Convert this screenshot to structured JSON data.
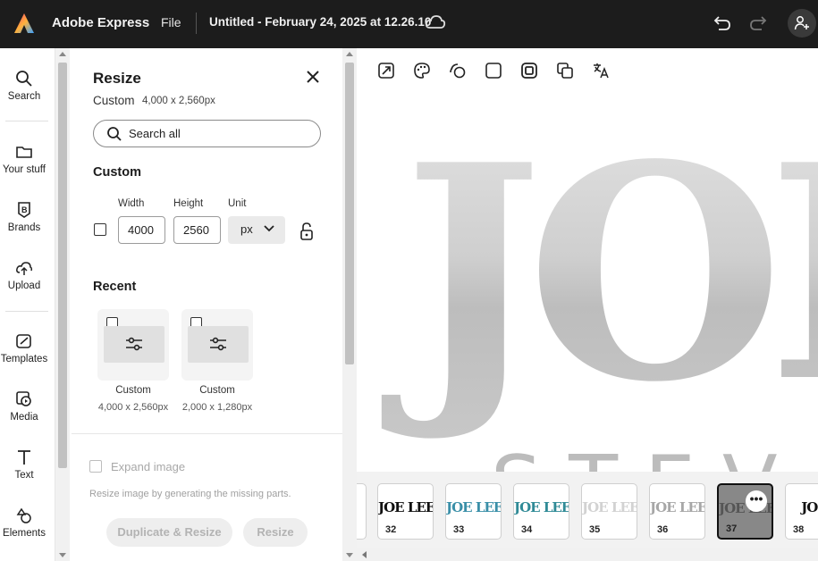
{
  "header": {
    "app_name": "Adobe Express",
    "file_menu": "File",
    "doc_title": "Untitled - February 24, 2025 at 12.26.10"
  },
  "rail": [
    {
      "label": "Search",
      "icon": "search-icon"
    },
    {
      "label": "Your stuff",
      "icon": "folder-icon"
    },
    {
      "label": "Brands",
      "icon": "brand-icon"
    },
    {
      "label": "Upload",
      "icon": "upload-icon"
    },
    {
      "label": "Templates",
      "icon": "templates-icon"
    },
    {
      "label": "Media",
      "icon": "media-icon"
    },
    {
      "label": "Text",
      "icon": "text-icon"
    },
    {
      "label": "Elements",
      "icon": "elements-icon"
    }
  ],
  "panel": {
    "title": "Resize",
    "current_name": "Custom",
    "current_dims": "4,000 x 2,560px",
    "search_placeholder": "Search all",
    "custom_heading": "Custom",
    "width_label": "Width",
    "height_label": "Height",
    "unit_label": "Unit",
    "width_value": "4000",
    "height_value": "2560",
    "unit_value": "px",
    "recent_heading": "Recent",
    "recent": [
      {
        "name": "Custom",
        "dims": "4,000 x 2,560px"
      },
      {
        "name": "Custom",
        "dims": "2,000 x 1,280px"
      }
    ],
    "expand_label": "Expand image",
    "expand_hint": "Resize image by generating the missing parts.",
    "duplicate_resize_label": "Duplicate & Resize",
    "resize_label": "Resize"
  },
  "canvas": {
    "headline": "JOE",
    "subline": "STEV"
  },
  "filmstrip": [
    {
      "page": "32",
      "text": "JOE LEE STEVENS",
      "color": "#111111"
    },
    {
      "page": "33",
      "text": "JOE LEE STEVENS",
      "color": "#3a8fa8"
    },
    {
      "page": "34",
      "text": "JOE LEE STEVENS",
      "color": "#2f8a96"
    },
    {
      "page": "35",
      "text": "JOE LEE",
      "color": "#d2d2d2"
    },
    {
      "page": "36",
      "text": "JOE LEE",
      "color": "#a7a7a7"
    },
    {
      "page": "37",
      "text": "JOE LEE",
      "color": "#555555"
    },
    {
      "page": "38",
      "text": "JOE",
      "color": "#111111"
    }
  ],
  "colors": {
    "topbar": "#1c1c1c",
    "canvas_letters": "#c9c9c9"
  }
}
